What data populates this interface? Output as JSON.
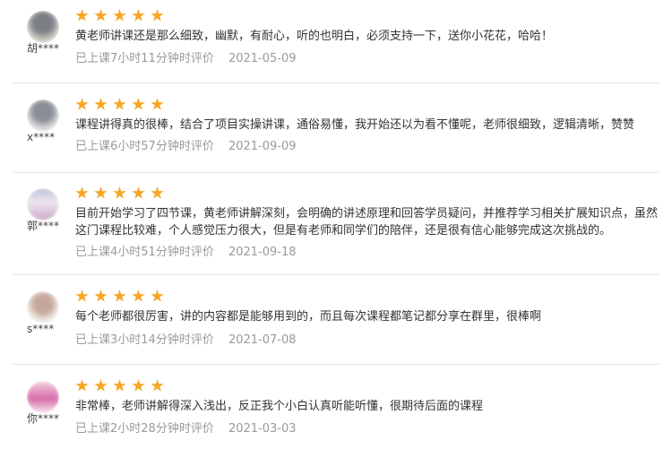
{
  "review_list": {
    "reviews": [
      {
        "user": "胡****",
        "avatar_colors": [
          "#7a7f86",
          "#c9c3bc"
        ],
        "rating": 5,
        "comment": "黄老师讲课还是那么细致，幽默，有耐心，听的也明白，必须支持一下，送你小花花，哈哈！",
        "time_ago": "已上课7小时11分钟时评价",
        "date": "2021-05-09"
      },
      {
        "user": "x****",
        "avatar_colors": [
          "#8a8f96",
          "#d7d7d7"
        ],
        "rating": 5,
        "comment": "课程讲得真的很棒，结合了项目实操讲课，通俗易懂，我开始还以为看不懂呢，老师很细致，逻辑清晰，赞赞",
        "time_ago": "已上课6小时57分钟时评价",
        "date": "2021-09-09"
      },
      {
        "user": "郭****",
        "avatar_colors": [
          "#b8c2d8",
          "#efe7ee"
        ],
        "rating": 5,
        "comment": "目前开始学习了四节课，黄老师讲解深刻，会明确的讲述原理和回答学员疑问，并推荐学习相关扩展知识点，虽然这门课程比较难，个人感觉压力很大，但是有老师和同学们的陪伴，还是很有信心能够完成这次挑战的。",
        "time_ago": "已上课4小时51分钟时评价",
        "date": "2021-09-18"
      },
      {
        "user": "s****",
        "avatar_colors": [
          "#c4a79b",
          "#efe8e2"
        ],
        "rating": 5,
        "comment": "每个老师都很厉害，讲的内容都是能够用到的，而且每次课程都笔记都分享在群里，很棒啊",
        "time_ago": "已上课3小时14分钟时评价",
        "date": "2021-07-08"
      },
      {
        "user": "你****",
        "avatar_colors": [
          "#d86aa8",
          "#f3d6e4"
        ],
        "rating": 5,
        "comment": "非常棒，老师讲解得深入浅出，反正我个小白认真听能听懂，很期待后面的课程",
        "time_ago": "已上课2小时28分钟时评价",
        "date": "2021-03-03"
      }
    ]
  },
  "colors": {
    "star": "#f6a623",
    "comment_text": "#333333",
    "meta_text": "#9a9a9a",
    "divider": "#e6e6e6"
  },
  "icons": {
    "star": "star-icon"
  }
}
